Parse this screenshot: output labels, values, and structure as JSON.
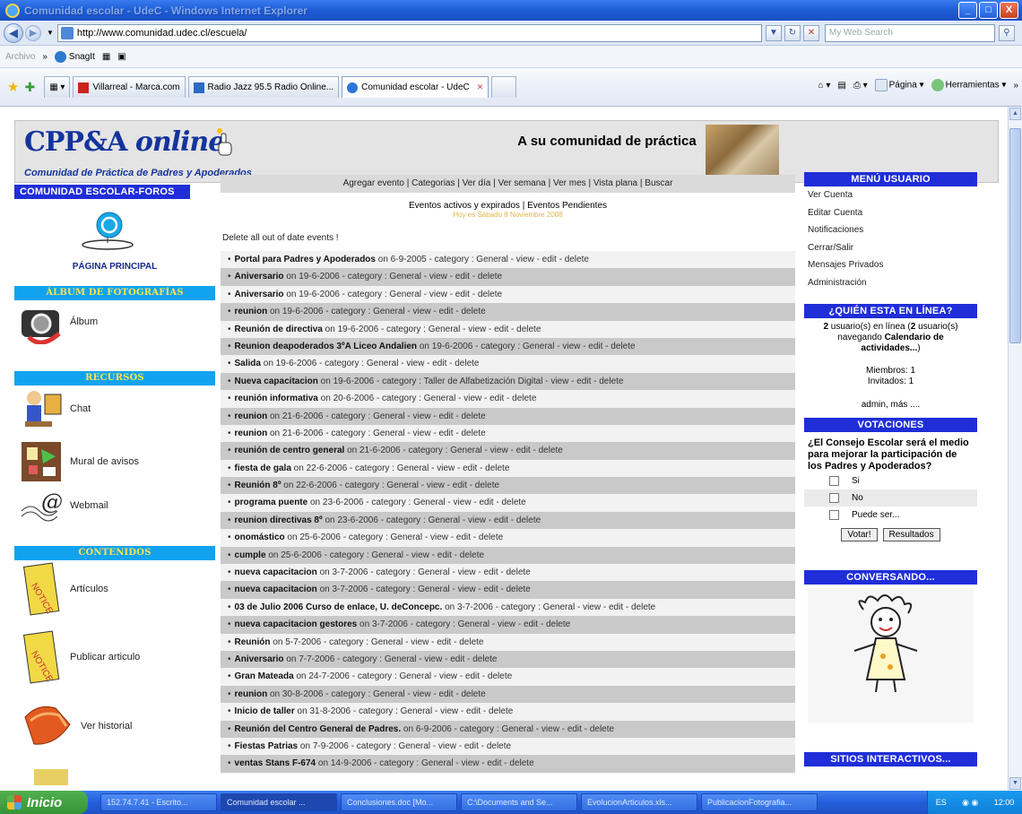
{
  "window": {
    "title": "Comunidad escolar - UdeC - Windows Internet Explorer",
    "buttons": {
      "minimize": "_",
      "maximize": "□",
      "close": "X"
    }
  },
  "address_bar": {
    "url": "http://www.comunidad.udec.cl/escuela/",
    "search_placeholder": "My Web Search"
  },
  "links_bar": {
    "archivo": "Archivo",
    "chevron": "»",
    "snagit": "SnagIt"
  },
  "tabs": [
    {
      "label": "Villarreal - Marca.com",
      "color": "#c8261d"
    },
    {
      "label": "Radio Jazz 95.5 Radio Online...",
      "color": "#2b6bc8"
    },
    {
      "label": "Comunidad escolar - UdeC",
      "color": "#2d76d8",
      "active": true
    }
  ],
  "command_bar": {
    "page": "Página",
    "tools": "Herramientas"
  },
  "site": {
    "logo_main": "CPP&A",
    "logo_italic": "online",
    "logo_sub": "Comunidad de Práctica de Padres y Apoderados",
    "tagline": "A su comunidad de práctica"
  },
  "left": {
    "foros_header": "COMUNIDAD ESCOLAR-FOROS",
    "pagina_principal": "PÁGINA PRINCIPAL",
    "album_header": "ÁLBUM DE FOTOGRAFÍAS",
    "album": "Álbum",
    "recursos_header": "RECURSOS",
    "chat": "Chat",
    "mural": "Mural de avisos",
    "webmail": "Webmail",
    "contenidos_header": "CONTENIDOS",
    "articulos": "Artículos",
    "publicar": "Publicar articulo",
    "historial": "Ver historial"
  },
  "center": {
    "topnav": "Agregar evento | Categorias | Ver día | Ver semana | Ver mes | Vista plana | Buscar",
    "subnav": "Eventos activos y expirados | Eventos Pendientes",
    "today": "Hoy es Sábado 8 Noviembre 2008",
    "delete_all": "Delete all out of date events !",
    "events": [
      {
        "title": "Portal para Padres y Apoderados",
        "date": "6-9-2005",
        "category": "General"
      },
      {
        "title": "Aniversario",
        "date": "19-6-2006",
        "category": "General"
      },
      {
        "title": "Aniversario",
        "date": "19-6-2006",
        "category": "General"
      },
      {
        "title": "reunion",
        "date": "19-6-2006",
        "category": "General"
      },
      {
        "title": "Reunión de directiva",
        "date": "19-6-2006",
        "category": "General"
      },
      {
        "title": "Reunion deapoderados 3ºA Liceo Andalien",
        "date": "19-6-2006",
        "category": "General"
      },
      {
        "title": "Salida",
        "date": "19-6-2006",
        "category": "General"
      },
      {
        "title": "Nueva capacitacion",
        "date": "19-6-2006",
        "category": "Taller de Alfabetización Digital"
      },
      {
        "title": "reunión informativa",
        "date": "20-6-2006",
        "category": "General"
      },
      {
        "title": "reunion",
        "date": "21-6-2006",
        "category": "General"
      },
      {
        "title": "reunion",
        "date": "21-6-2006",
        "category": "General"
      },
      {
        "title": "reunión de centro general",
        "date": "21-6-2006",
        "category": "General"
      },
      {
        "title": "fiesta de gala",
        "date": "22-6-2006",
        "category": "General"
      },
      {
        "title": "Reunión 8º",
        "date": "22-6-2006",
        "category": "General"
      },
      {
        "title": "programa puente",
        "date": "23-6-2006",
        "category": "General"
      },
      {
        "title": "reunion directivas 8º",
        "date": "23-6-2006",
        "category": "General"
      },
      {
        "title": "onomástico",
        "date": "25-6-2006",
        "category": "General"
      },
      {
        "title": "cumple",
        "date": "25-6-2006",
        "category": "General"
      },
      {
        "title": "nueva capacitacion",
        "date": "3-7-2006",
        "category": "General"
      },
      {
        "title": "nueva capacitacion",
        "date": "3-7-2006",
        "category": "General"
      },
      {
        "title": "03 de Julio 2006 Curso de enlace, U. deConcepc.",
        "date": "3-7-2006",
        "category": "General"
      },
      {
        "title": "nueva capacitacion gestores",
        "date": "3-7-2006",
        "category": "General"
      },
      {
        "title": "Reunión",
        "date": "5-7-2006",
        "category": "General"
      },
      {
        "title": "Aniversario",
        "date": "7-7-2006",
        "category": "General"
      },
      {
        "title": "Gran Mateada",
        "date": "24-7-2006",
        "category": "General"
      },
      {
        "title": "reunion",
        "date": "30-8-2006",
        "category": "General"
      },
      {
        "title": "Inicio de taller",
        "date": "31-8-2006",
        "category": "General"
      },
      {
        "title": "Reunión del Centro General de Padres.",
        "date": "6-9-2006",
        "category": "General"
      },
      {
        "title": "Fiestas Patrias",
        "date": "7-9-2006",
        "category": "General"
      },
      {
        "title": "ventas Stans F-674",
        "date": "14-9-2006",
        "category": "General"
      }
    ],
    "words": {
      "on": "on",
      "category": "category",
      "view": "view",
      "edit": "edit",
      "delete": "delete"
    }
  },
  "right": {
    "menu_header": "MENÚ USUARIO",
    "menu": [
      "Ver Cuenta",
      "Editar Cuenta",
      "Notificaciones",
      "Cerrar/Salir",
      "Mensajes Privados",
      "Administración"
    ],
    "online_header": "¿QUIÉN ESTA EN LÍNEA?",
    "online_users": "2",
    "online_text1": " usuario(s) en línea (",
    "online_text2": "2",
    "online_text3": " usuario(s) navegando ",
    "online_target": "Calendario de actividades...",
    "online_close": ")",
    "members": "Miembros: 1",
    "guests": "Invitados: 1",
    "admin": "admin, más ....",
    "votaciones_header": "VOTACIONES",
    "poll_question": "¿El Consejo Escolar será el medio para mejorar la participación de los Padres y Apoderados?",
    "options": [
      "Si",
      "No",
      "Puede ser..."
    ],
    "votar": "Votar!",
    "resultados": "Resultados",
    "conversando_header": "CONVERSANDO...",
    "sitios_header": "SITIOS INTERACTIVOS..."
  },
  "taskbar": {
    "start": "Inicio",
    "items": [
      "152.74.7.41 - Escrito...",
      "Comunidad escolar ...",
      "Conclusiones.doc [Mo...",
      "C:\\Documents and Se...",
      "EvolucionArticulos.xls...",
      "PublicacionFotografia..."
    ],
    "lang": "ES",
    "clock": "12:00"
  }
}
